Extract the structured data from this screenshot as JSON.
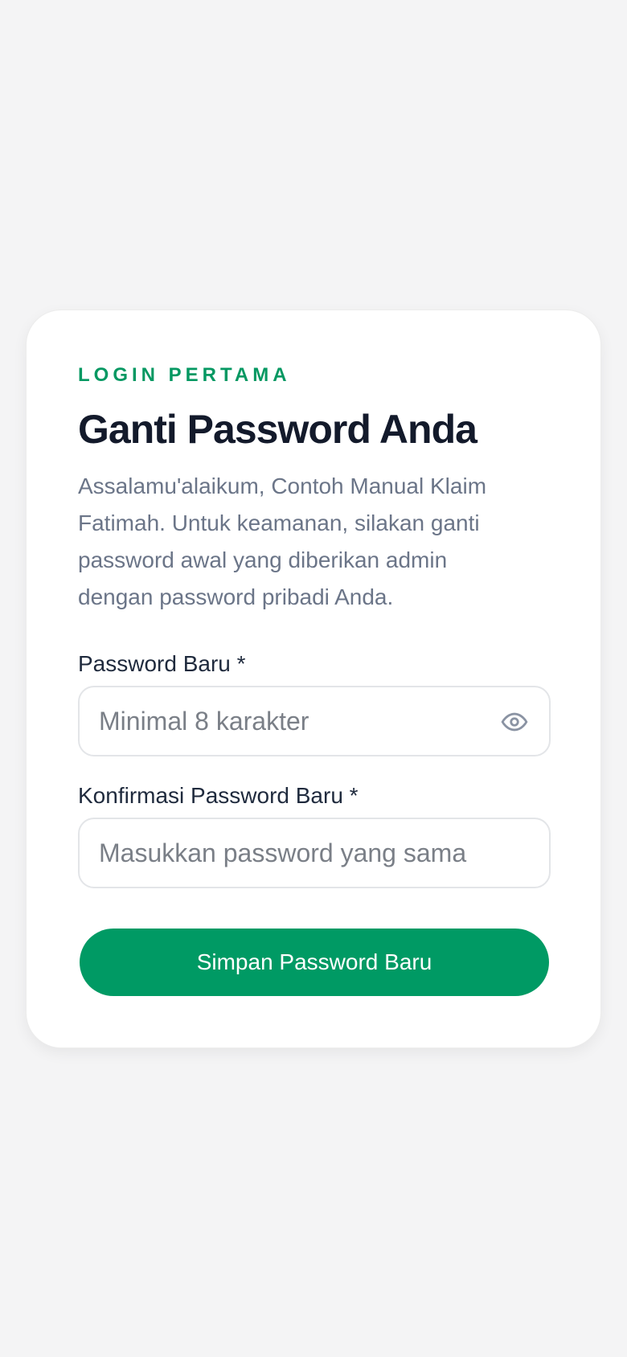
{
  "card": {
    "eyebrow": "LOGIN PERTAMA",
    "title": "Ganti Password Anda",
    "description": "Assalamu'alaikum, Contoh Manual Klaim Fatimah. Untuk keamanan, silakan ganti password awal yang diberikan admin dengan password pribadi Anda."
  },
  "form": {
    "new_password": {
      "label": "Password Baru *",
      "placeholder": "Minimal 8 karakter",
      "value": "",
      "icon": "eye-icon"
    },
    "confirm_password": {
      "label": "Konfirmasi Password Baru *",
      "placeholder": "Masukkan password yang sama",
      "value": ""
    },
    "submit_label": "Simpan Password Baru"
  },
  "colors": {
    "background": "#f4f4f5",
    "card": "#ffffff",
    "accent": "#009a64",
    "eyebrow": "#059862",
    "title": "#131a2b",
    "body_text": "#6b7588",
    "label": "#1f2a3d",
    "input_border": "#e3e5e8",
    "icon": "#8a93a3"
  }
}
